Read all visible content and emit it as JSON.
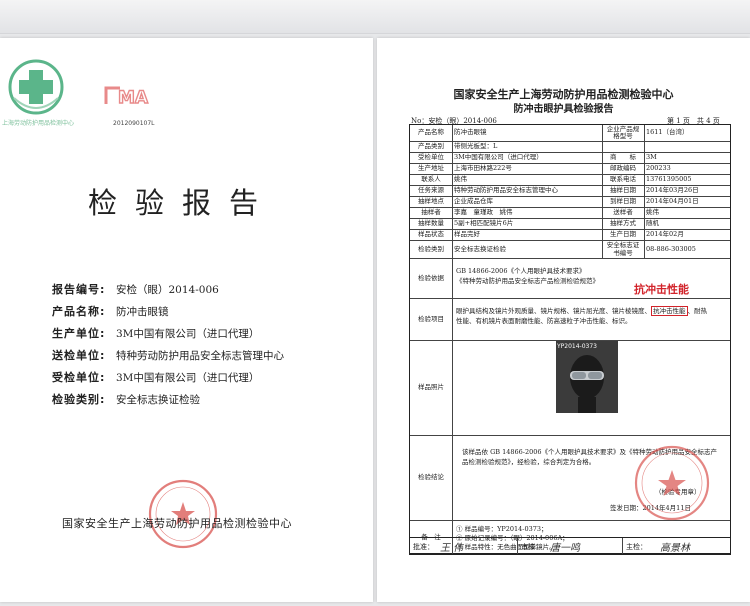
{
  "cover": {
    "logo_caption": "上海劳动防护用品检测中心",
    "ma_logo_text": "MA",
    "ma_code": "2012090107L",
    "title": "检验报告",
    "fields": [
      {
        "label": "报告编号:",
        "value": "安检（眼）2014-006"
      },
      {
        "label": "产品名称:",
        "value": "防冲击眼镜"
      },
      {
        "label": "生产单位:",
        "value": "3M中国有限公司（进口代理）"
      },
      {
        "label": "送检单位:",
        "value": "特种劳动防护用品安全标志管理中心"
      },
      {
        "label": "受检单位:",
        "value": "3M中国有限公司（进口代理）"
      },
      {
        "label": "检验类别:",
        "value": "安全标志换证检验"
      }
    ],
    "footer_org": "国家安全生产上海劳动防护用品检测检验中心"
  },
  "report": {
    "title1": "国家安全生产上海劳动防护用品检测检验中心",
    "title2": "防冲击眼护具检验报告",
    "report_no": "No：安检（眼）2014-006",
    "pages": "第 1 页　共 4 页",
    "rows": [
      {
        "l1": "产品名称",
        "v1": "防冲击眼镜",
        "l2": "企业产品规格型号",
        "v2": "1611（台湾）"
      },
      {
        "l1": "产品类别",
        "v1": "带侧光板型：L",
        "l2": "",
        "v2": ""
      },
      {
        "l1": "受检单位",
        "v1": "3M中国有限公司（进口代理）",
        "l2": "商　　标",
        "v2": "3M"
      },
      {
        "l1": "生产地址",
        "v1": "上海市田林路222号",
        "l2": "邮政编码",
        "v2": "200233"
      },
      {
        "l1": "联系人",
        "v1": "姚伟",
        "l2": "联系电话",
        "v2": "13761395005"
      },
      {
        "l1": "任务来源",
        "v1": "特种劳动防护用品安全标志管理中心",
        "l2": "抽样日期",
        "v2": "2014年03月26日"
      },
      {
        "l1": "抽样地点",
        "v1": "企业成品仓库",
        "l2": "到样日期",
        "v2": "2014年04月01日"
      },
      {
        "l1": "抽样者",
        "v1": "李嘉　童瑾政　姚伟",
        "l2": "送样者",
        "v2": "姚伟"
      },
      {
        "l1": "抽样数量",
        "v1": "5副+相匹配镜片6片",
        "l2": "抽样方式",
        "v2": "随机"
      },
      {
        "l1": "样品状态",
        "v1": "样品完好",
        "l2": "生产日期",
        "v2": "2014年02月"
      },
      {
        "l1": "检验类别",
        "v1": "安全标志换证检验",
        "l2": "安全标志证书编号",
        "v2": "08-886-303005"
      }
    ],
    "basis_label": "检验依据",
    "basis_text_1": "GB 14866-2006《个人用眼护具技术要求》",
    "basis_text_2": "《特种劳动防护用品安全标志产品检测检验规范》",
    "items_label": "检验项目",
    "items_before": "眼护具结构及镜片外观质量、镜片规格、镜片屈光度、镜片棱镜度、",
    "items_highlight": "抗冲击性能",
    "items_after": "、耐热",
    "items_line2": "性能、有机镜片表面耐磨性能、防高速粒子冲击性能、标识。",
    "red_note": "抗冲击性能",
    "photo_label": "样品照片",
    "photo_code": "YP2014-0373",
    "conclusion_label": "检验结论",
    "conclusion_text": "该样品依 GB 14866-2006《个人用眼护具技术要求》及《特种劳动防护用品安全标志产品检测检验规范》，经检验，综合判定为合格。",
    "stamp_caption": "（检验专用章）",
    "issue_date_label": "签发日期：",
    "issue_date_value": "2014年4月11日",
    "remarks_label": "备　注",
    "remarks": [
      "① 样品编号：YP2014-0373；",
      "② 原始记录编号：（眼）2014-006A；",
      "③ 样品特性：无色曲面型单镜片。"
    ],
    "approve_label": "批准：",
    "approve_sig": "王 伟",
    "review_label": "审核：",
    "review_sig": "唐一鸣",
    "main_label": "主检：",
    "main_sig": "高景林"
  },
  "colors": {
    "accent_red": "#d2232a",
    "stamp_red": "#d9534f",
    "logo_green": "#5bb58a"
  }
}
